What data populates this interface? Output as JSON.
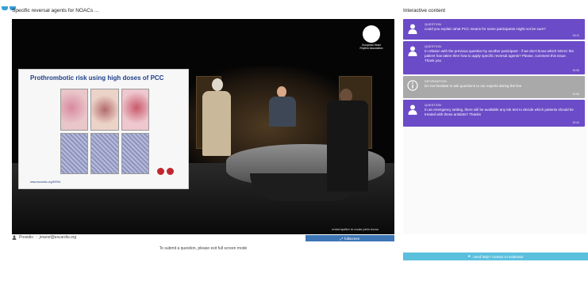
{
  "video": {
    "title": "Specific reversal agents for NOACs ...",
    "slide_title": "Prothrombotic risk using high doses of PCC",
    "slide_footer": "www.escardio.org/EHRA",
    "broadcast_logo_text": "European Heart Rhythm Association",
    "exit_hint": "entrer/quitter le mode plein écran",
    "presenter_label": "Presidio",
    "presenter_email": "jmarot@escardio.org",
    "fullscreen_label": "fullscreen",
    "submit_note": "To submit a question, please exit full screen mode"
  },
  "panel": {
    "title": "Interactive content",
    "messages": [
      {
        "kind": "question",
        "label": "QUESTION",
        "text": "could you explain what PCC means for some participants might not be sure?",
        "time": "16:11",
        "icon": "user-icon"
      },
      {
        "kind": "question",
        "label": "QUESTION",
        "text": "In relation with the previous question by another participant - if we don't know which NOAC the patient has taken then how to apply specific reversal agents? Please, comment this issue. Thank you",
        "time": "16:06",
        "icon": "user-icon"
      },
      {
        "kind": "info",
        "label": "INFORMATION",
        "text": "Do not hesitate to ask questions to our experts during the live",
        "time": "15:56",
        "icon": "info-icon"
      },
      {
        "kind": "question",
        "label": "QUESTION",
        "text": "In an emergency setting, there will be available any lab test to decide which patients should be treated with these antidots? Thanks",
        "time": "15:40",
        "icon": "user-icon"
      }
    ],
    "help_label": "need help? contact a moderator"
  },
  "colors": {
    "question_bg": "#6b4bc7",
    "info_bg": "#a9a9a9",
    "fullscreen_bg": "#3c76b5",
    "help_bg": "#5bc0de"
  }
}
